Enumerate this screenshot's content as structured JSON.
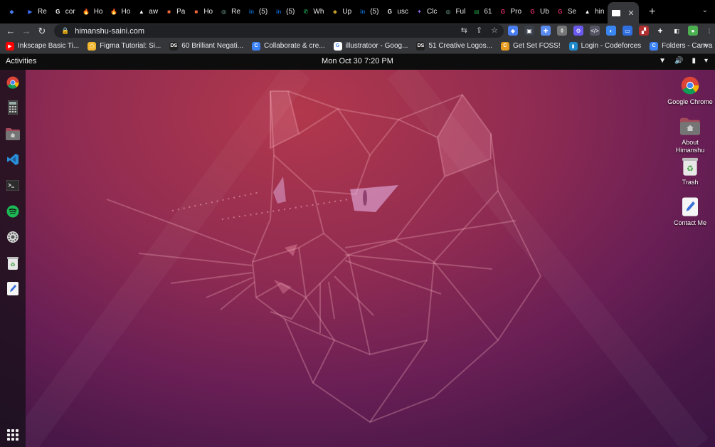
{
  "browser": {
    "tabs": [
      {
        "label": "",
        "icon": "gem-icon",
        "color": "#4a7df0",
        "glyph": "◆"
      },
      {
        "label": "Re",
        "icon": "play-icon",
        "color": "#3a6ff0",
        "glyph": "▶"
      },
      {
        "label": "cor",
        "icon": "google-icon",
        "color": "#ffffff",
        "glyph": "G"
      },
      {
        "label": "Ho",
        "icon": "firebase-icon",
        "color": "#f6a623",
        "glyph": "🔥"
      },
      {
        "label": "Ho",
        "icon": "firebase-icon",
        "color": "#f6a623",
        "glyph": "🔥"
      },
      {
        "label": "aw",
        "icon": "vercel-icon",
        "color": "#ffffff",
        "glyph": "▲"
      },
      {
        "label": "Pa",
        "icon": "orange-square-icon",
        "color": "#f26b3a",
        "glyph": "■"
      },
      {
        "label": "Ho",
        "icon": "orange-square-icon",
        "color": "#f26b3a",
        "glyph": "■"
      },
      {
        "label": "Re",
        "icon": "chatgpt-icon",
        "color": "#74aa9c",
        "glyph": "◎"
      },
      {
        "label": "(5)",
        "icon": "linkedin-icon",
        "color": "#0a66c2",
        "glyph": "in"
      },
      {
        "label": "(5)",
        "icon": "linkedin-icon",
        "color": "#0a66c2",
        "glyph": "in"
      },
      {
        "label": "Wh",
        "icon": "whatsapp-icon",
        "color": "#25d366",
        "glyph": "✆"
      },
      {
        "label": "Up",
        "icon": "shield-icon",
        "color": "#f2c230",
        "glyph": "◈"
      },
      {
        "label": "(5)",
        "icon": "linkedin-icon",
        "color": "#0a66c2",
        "glyph": "in"
      },
      {
        "label": "usc",
        "icon": "google-icon",
        "color": "#ffffff",
        "glyph": "G"
      },
      {
        "label": "Clc",
        "icon": "claude-icon",
        "color": "#9b6cf0",
        "glyph": "✦"
      },
      {
        "label": "Ful",
        "icon": "chatgpt-icon",
        "color": "#74aa9c",
        "glyph": "◎"
      },
      {
        "label": "61",
        "icon": "sheets-icon",
        "color": "#1e8e3e",
        "glyph": "▤"
      },
      {
        "label": "Pro",
        "icon": "g-circle-icon",
        "color": "#e1306c",
        "glyph": "G"
      },
      {
        "label": "Ub",
        "icon": "g-circle-icon",
        "color": "#e1306c",
        "glyph": "G"
      },
      {
        "label": "Se",
        "icon": "g-circle-icon",
        "color": "#e1306c",
        "glyph": "G"
      },
      {
        "label": "hin",
        "icon": "vercel-icon",
        "color": "#ffffff",
        "glyph": "▲"
      }
    ],
    "active_tab": {
      "label": "",
      "icon": "page-icon",
      "close_glyph": "✕"
    },
    "new_tab_glyph": "+",
    "tab_list_glyph": "⌄",
    "toolbar": {
      "back_glyph": "←",
      "forward_glyph": "→",
      "reload_glyph": "↻",
      "lock_glyph": "🔒",
      "url": "himanshu-saini.com",
      "translate_glyph": "⇆",
      "share_glyph": "⇪",
      "star_glyph": "☆"
    },
    "extensions": [
      {
        "icon": "gem-ext-icon",
        "color": "#4a7df0",
        "glyph": "◆"
      },
      {
        "icon": "screenshot-ext-icon",
        "color": "#3a3f4a",
        "glyph": "▣"
      },
      {
        "icon": "puzzle-blue-icon",
        "color": "#5a8cf0",
        "glyph": "✚"
      },
      {
        "icon": "bottle-ext-icon",
        "color": "#777777",
        "glyph": "⚱"
      },
      {
        "icon": "gear-ext-icon",
        "color": "#6a5af0",
        "glyph": "⚙"
      },
      {
        "icon": "dev-ext-icon",
        "color": "#556",
        "glyph": "</>"
      },
      {
        "icon": "color-ext-icon",
        "color": "#3a86f0",
        "glyph": "◐"
      },
      {
        "icon": "window-ext-icon",
        "color": "#2f6fe0",
        "glyph": "▭"
      },
      {
        "icon": "checker-ext-icon",
        "color": "#b03030",
        "glyph": "▞"
      },
      {
        "icon": "extensions-icon",
        "color": "#35363a",
        "glyph": "✚"
      },
      {
        "icon": "side-panel-icon",
        "color": "#35363a",
        "glyph": "◧"
      },
      {
        "icon": "profile-avatar-icon",
        "color": "#4caf50",
        "glyph": "●"
      },
      {
        "icon": "menu-kebab-icon",
        "color": "#35363a",
        "glyph": "⋮"
      }
    ],
    "bookmarks": [
      {
        "label": "Inkscape Basic Ti...",
        "icon": "youtube-icon",
        "color": "#ff0000",
        "glyph": "▶"
      },
      {
        "label": "Figma Tutorial: Si...",
        "icon": "figma-hex-icon",
        "color": "#f2b630",
        "glyph": "⬡"
      },
      {
        "label": "60 Brilliant Negati...",
        "icon": "ds-icon",
        "color": "#222222",
        "glyph": "DS"
      },
      {
        "label": "Collaborate & cre...",
        "icon": "canva-icon",
        "color": "#3b82f6",
        "glyph": "C"
      },
      {
        "label": "illustratoor - Goog...",
        "icon": "google-icon",
        "color": "#ffffff",
        "glyph": "G"
      },
      {
        "label": "51 Creative Logos...",
        "icon": "ds-icon",
        "color": "#222222",
        "glyph": "DS"
      },
      {
        "label": "Get Set FOSS!",
        "icon": "foss-icon",
        "color": "#e69b1e",
        "glyph": "C"
      },
      {
        "label": "Login - Codeforces",
        "icon": "codeforces-icon",
        "color": "#1f8acb",
        "glyph": "▮"
      },
      {
        "label": "Folders - Canva",
        "icon": "canva-icon",
        "color": "#3b82f6",
        "glyph": "C"
      }
    ],
    "bookmarks_more_glyph": "»"
  },
  "system_bar": {
    "activities": "Activities",
    "clock": "Mon Oct 30  7:20 PM",
    "tray": {
      "network_glyph": "▼",
      "volume_glyph": "🔊",
      "battery_glyph": "▮",
      "menu_glyph": "▾"
    }
  },
  "dock": [
    {
      "icon": "chrome-icon"
    },
    {
      "icon": "calculator-icon"
    },
    {
      "icon": "home-folder-icon"
    },
    {
      "icon": "vscode-icon"
    },
    {
      "icon": "terminal-icon"
    },
    {
      "icon": "spotify-icon"
    },
    {
      "icon": "settings-icon"
    },
    {
      "icon": "trash-icon"
    },
    {
      "icon": "text-editor-icon"
    }
  ],
  "desktop_icons": [
    {
      "label": "Google Chrome",
      "icon": "chrome-icon"
    },
    {
      "label": "About Himanshu",
      "icon": "home-folder-icon"
    },
    {
      "label": "Trash",
      "icon": "trash-icon"
    },
    {
      "label": "Contact Me",
      "icon": "text-editor-icon"
    }
  ]
}
